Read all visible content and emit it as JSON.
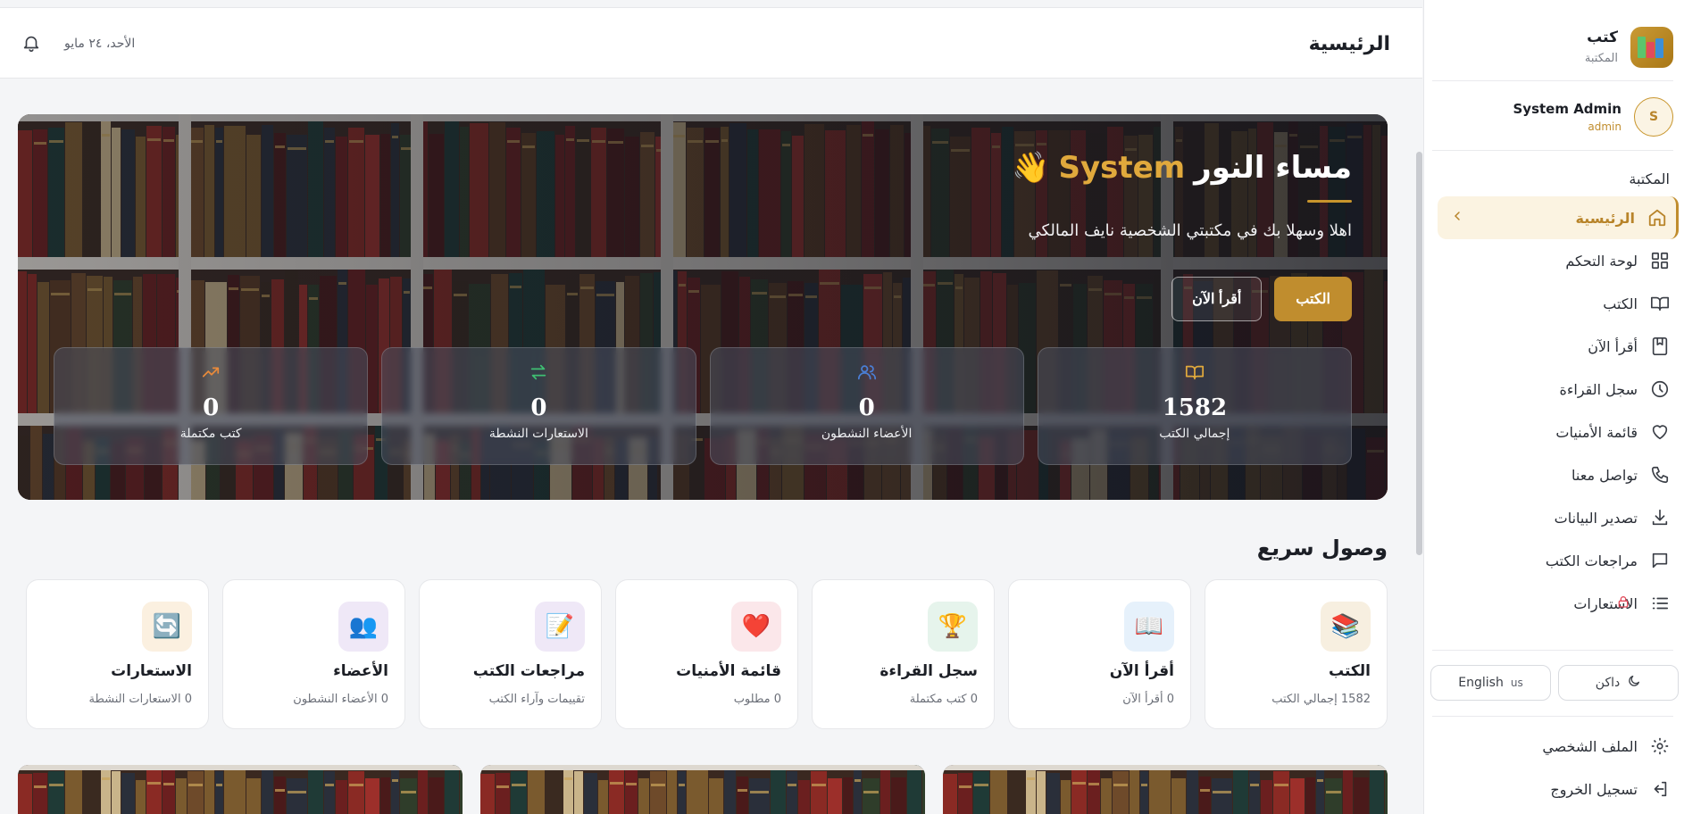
{
  "brand": {
    "name": "كتب",
    "subtitle": "المكتبة"
  },
  "user": {
    "initial": "S",
    "name": "System Admin",
    "role": "admin"
  },
  "sidebar": {
    "section_title": "المكتبة",
    "items": [
      {
        "label": "الرئيسية",
        "icon": "home-icon",
        "active": true
      },
      {
        "label": "لوحة التحكم",
        "icon": "dashboard-grid-icon"
      },
      {
        "label": "الكتب",
        "icon": "open-book-icon"
      },
      {
        "label": "أقرأ الآن",
        "icon": "bookmark-book-icon"
      },
      {
        "label": "سجل القراءة",
        "icon": "clock-icon"
      },
      {
        "label": "قائمة الأمنيات",
        "icon": "heart-icon"
      },
      {
        "label": "تواصل معنا",
        "icon": "phone-icon"
      },
      {
        "label": "تصدير البيانات",
        "icon": "download-icon"
      },
      {
        "label": "مراجعات الكتب",
        "icon": "message-square-icon"
      },
      {
        "label": "الاستعارات",
        "icon": "list-icon",
        "locked": true
      }
    ],
    "theme_toggle": "داكن",
    "language_toggle": "English",
    "language_flag": "us",
    "profile": "الملف الشخصي",
    "logout": "تسجيل الخروج"
  },
  "topbar": {
    "title": "الرئيسية",
    "date": "الأحد، ٢٤ مايو"
  },
  "hero": {
    "greeting": "مساء النور",
    "name": "System",
    "wave": "👋",
    "subtitle": "اهلا وسهلا بك في مكتبتي الشخصية نايف المالكي",
    "primary_button": "الكتب",
    "secondary_button": "أقرأ الآن",
    "stats": [
      {
        "value": "1582",
        "label": "إجمالي الكتب",
        "icon": "book-icon",
        "color": "#e0a93c"
      },
      {
        "value": "0",
        "label": "الأعضاء النشطون",
        "icon": "users-icon",
        "color": "#4a7fd6"
      },
      {
        "value": "0",
        "label": "الاستعارات النشطة",
        "icon": "arrows-swap-icon",
        "color": "#3fbf72"
      },
      {
        "value": "0",
        "label": "كتب مكتملة",
        "icon": "trending-up-icon",
        "color": "#e98a3a"
      }
    ]
  },
  "quick_access": {
    "title": "وصول سريع",
    "cards": [
      {
        "name": "الكتب",
        "meta": "1582 إجمالي الكتب",
        "emoji": "📚",
        "bg": "#f7efe0"
      },
      {
        "name": "أقرأ الآن",
        "meta": "0 أقرأ الآن",
        "emoji": "📖",
        "bg": "#e6f1fb"
      },
      {
        "name": "سجل القراءة",
        "meta": "0 كتب مكتملة",
        "emoji": "🏆",
        "bg": "#e6f4ec"
      },
      {
        "name": "قائمة الأمنيات",
        "meta": "0 مطلوب",
        "emoji": "❤️",
        "bg": "#fbe7ea"
      },
      {
        "name": "مراجعات الكتب",
        "meta": "تقييمات وآراء الكتب",
        "emoji": "📝",
        "bg": "#efe8f7"
      },
      {
        "name": "الأعضاء",
        "meta": "0 الأعضاء النشطون",
        "emoji": "👥",
        "bg": "#efe8f7"
      },
      {
        "name": "الاستعارات",
        "meta": "0 الاستعارات النشطة",
        "emoji": "🔄",
        "bg": "#fbf0e0"
      }
    ]
  },
  "colors": {
    "accent": "#c08d2e",
    "sidebar_active_bg": "#fbf3e1"
  }
}
